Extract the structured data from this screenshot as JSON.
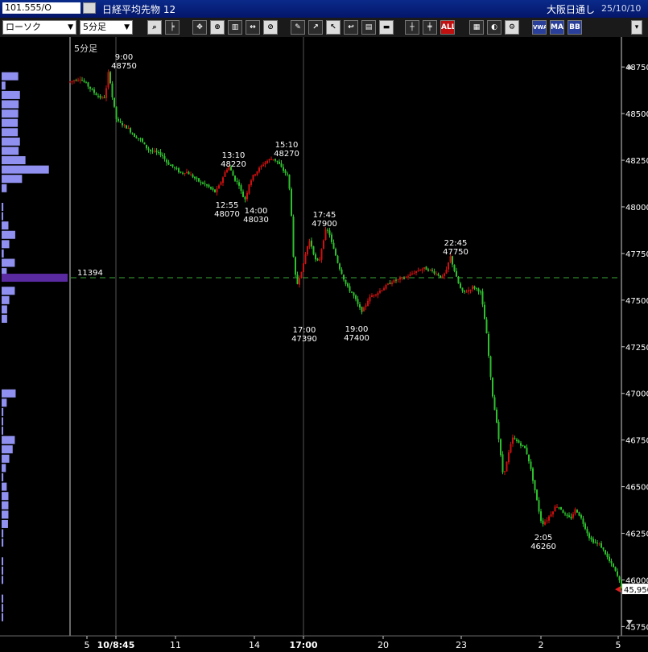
{
  "window": {
    "symbol": "101.555/O",
    "name": "日経平均先物 12",
    "market": "大阪日通し",
    "date": "25/10/10"
  },
  "toolbar": {
    "chart_type": "ローソク",
    "interval": "5分足",
    "buttons": [
      {
        "name": "zoom-button",
        "icon": "magnifier-icon"
      },
      {
        "name": "draw-lines-button",
        "icon": "lines-icon"
      },
      {
        "name": "cursor-tool-button",
        "icon": "cursor-icon"
      },
      {
        "name": "zoom-tool-button",
        "icon": "zoom-icon"
      },
      {
        "name": "bar-count-button",
        "icon": "bars-icon"
      },
      {
        "name": "stretch-button",
        "icon": "stretch-icon"
      },
      {
        "name": "disabled-button",
        "icon": "disabled-icon"
      },
      {
        "name": "pen-button",
        "icon": "pen-icon"
      },
      {
        "name": "trend-tool-button",
        "icon": "trend-icon"
      },
      {
        "name": "select-tool-button",
        "icon": "arrow-icon"
      },
      {
        "name": "undo-button",
        "icon": "undo-icon"
      },
      {
        "name": "memo-button",
        "icon": "memo-icon"
      },
      {
        "name": "delete-button",
        "icon": "trash-icon"
      },
      {
        "name": "candle-button",
        "icon": "candle-icon"
      },
      {
        "name": "candle2-button",
        "icon": "candle2-icon"
      },
      {
        "name": "all-button",
        "label": "ALL"
      },
      {
        "name": "pattern-button",
        "icon": "pattern-icon"
      },
      {
        "name": "color-button",
        "icon": "palette-icon"
      },
      {
        "name": "settings-button",
        "icon": "gear-icon"
      },
      {
        "name": "vwap-button",
        "label": "VWAP"
      },
      {
        "name": "ma-button",
        "label": "MA"
      },
      {
        "name": "bb-button",
        "label": "BB"
      }
    ]
  },
  "chart_data": {
    "type": "candlestick",
    "interval_label": "5分足",
    "ylim": [
      45750,
      48775
    ],
    "y_ticks": [
      48750,
      48500,
      48250,
      48000,
      47750,
      47500,
      47250,
      47000,
      46750,
      46500,
      46250,
      46000,
      45750
    ],
    "x_ticks": [
      "5",
      "10/8:45",
      "11",
      "14",
      "17:00",
      "20",
      "23",
      "2",
      "5"
    ],
    "current_price_label": "45,950",
    "current_price": 45950,
    "dashed_line_label": "11394",
    "dashed_line_price": 47620,
    "annotations": [
      {
        "time": "9:00",
        "price": 48750
      },
      {
        "time": "13:10",
        "price": 48220
      },
      {
        "time": "12:55",
        "price": 48070
      },
      {
        "time": "14:00",
        "price": 48030
      },
      {
        "time": "15:10",
        "price": 48270
      },
      {
        "time": "17:45",
        "price": 47900
      },
      {
        "time": "17:00",
        "price": 47390
      },
      {
        "time": "19:00",
        "price": 47400
      },
      {
        "time": "22:45",
        "price": 47750
      },
      {
        "time": "2:05",
        "price": 46260
      }
    ],
    "price_path": [
      [
        0,
        48670
      ],
      [
        6,
        48680
      ],
      [
        12,
        48690
      ],
      [
        20,
        48660
      ],
      [
        28,
        48620
      ],
      [
        36,
        48590
      ],
      [
        42,
        48580
      ],
      [
        46,
        48650
      ],
      [
        48,
        48740
      ],
      [
        52,
        48600
      ],
      [
        58,
        48460
      ],
      [
        66,
        48440
      ],
      [
        72,
        48420
      ],
      [
        80,
        48380
      ],
      [
        88,
        48360
      ],
      [
        94,
        48320
      ],
      [
        100,
        48300
      ],
      [
        108,
        48290
      ],
      [
        114,
        48280
      ],
      [
        120,
        48240
      ],
      [
        126,
        48220
      ],
      [
        132,
        48200
      ],
      [
        138,
        48180
      ],
      [
        144,
        48190
      ],
      [
        150,
        48170
      ],
      [
        156,
        48150
      ],
      [
        162,
        48130
      ],
      [
        168,
        48120
      ],
      [
        174,
        48100
      ],
      [
        180,
        48080
      ],
      [
        184,
        48100
      ],
      [
        188,
        48140
      ],
      [
        194,
        48200
      ],
      [
        198,
        48215
      ],
      [
        204,
        48150
      ],
      [
        210,
        48120
      ],
      [
        214,
        48060
      ],
      [
        218,
        48040
      ],
      [
        222,
        48120
      ],
      [
        228,
        48170
      ],
      [
        234,
        48200
      ],
      [
        240,
        48230
      ],
      [
        246,
        48250
      ],
      [
        252,
        48260
      ],
      [
        258,
        48240
      ],
      [
        264,
        48200
      ],
      [
        270,
        48170
      ],
      [
        274,
        48050
      ],
      [
        278,
        47680
      ],
      [
        282,
        47580
      ],
      [
        286,
        47640
      ],
      [
        290,
        47690
      ],
      [
        294,
        47780
      ],
      [
        298,
        47820
      ],
      [
        302,
        47760
      ],
      [
        306,
        47700
      ],
      [
        310,
        47720
      ],
      [
        314,
        47810
      ],
      [
        318,
        47880
      ],
      [
        322,
        47860
      ],
      [
        326,
        47790
      ],
      [
        330,
        47740
      ],
      [
        334,
        47680
      ],
      [
        338,
        47640
      ],
      [
        342,
        47590
      ],
      [
        346,
        47560
      ],
      [
        350,
        47540
      ],
      [
        354,
        47510
      ],
      [
        358,
        47470
      ],
      [
        362,
        47440
      ],
      [
        366,
        47460
      ],
      [
        370,
        47500
      ],
      [
        376,
        47530
      ],
      [
        382,
        47540
      ],
      [
        388,
        47560
      ],
      [
        394,
        47580
      ],
      [
        400,
        47600
      ],
      [
        408,
        47610
      ],
      [
        416,
        47620
      ],
      [
        424,
        47640
      ],
      [
        432,
        47660
      ],
      [
        440,
        47670
      ],
      [
        448,
        47660
      ],
      [
        456,
        47640
      ],
      [
        462,
        47620
      ],
      [
        468,
        47660
      ],
      [
        472,
        47740
      ],
      [
        476,
        47680
      ],
      [
        480,
        47620
      ],
      [
        484,
        47570
      ],
      [
        488,
        47540
      ],
      [
        494,
        47550
      ],
      [
        500,
        47570
      ],
      [
        506,
        47560
      ],
      [
        510,
        47540
      ],
      [
        514,
        47430
      ],
      [
        518,
        47300
      ],
      [
        522,
        47100
      ],
      [
        526,
        46950
      ],
      [
        530,
        46850
      ],
      [
        534,
        46700
      ],
      [
        538,
        46560
      ],
      [
        542,
        46620
      ],
      [
        546,
        46700
      ],
      [
        550,
        46760
      ],
      [
        556,
        46740
      ],
      [
        562,
        46720
      ],
      [
        566,
        46700
      ],
      [
        570,
        46640
      ],
      [
        574,
        46560
      ],
      [
        578,
        46470
      ],
      [
        582,
        46380
      ],
      [
        586,
        46300
      ],
      [
        592,
        46320
      ],
      [
        598,
        46360
      ],
      [
        604,
        46400
      ],
      [
        610,
        46380
      ],
      [
        616,
        46340
      ],
      [
        622,
        46330
      ],
      [
        628,
        46380
      ],
      [
        634,
        46340
      ],
      [
        640,
        46280
      ],
      [
        646,
        46220
      ],
      [
        652,
        46200
      ],
      [
        658,
        46190
      ],
      [
        664,
        46150
      ],
      [
        670,
        46100
      ],
      [
        676,
        46060
      ],
      [
        682,
        46000
      ],
      [
        688,
        45920
      ],
      [
        692,
        45950
      ]
    ],
    "volume_profile": [
      {
        "price": 48700,
        "volume": 3900
      },
      {
        "price": 48650,
        "volume": 900
      },
      {
        "price": 48600,
        "volume": 4300
      },
      {
        "price": 48550,
        "volume": 4000
      },
      {
        "price": 48500,
        "volume": 3900
      },
      {
        "price": 48450,
        "volume": 3800
      },
      {
        "price": 48400,
        "volume": 3800
      },
      {
        "price": 48350,
        "volume": 4300
      },
      {
        "price": 48300,
        "volume": 4000
      },
      {
        "price": 48250,
        "volume": 5600
      },
      {
        "price": 48200,
        "volume": 11100
      },
      {
        "price": 48150,
        "volume": 4800
      },
      {
        "price": 48100,
        "volume": 1200
      },
      {
        "price": 48050,
        "volume": 0
      },
      {
        "price": 48000,
        "volume": 400
      },
      {
        "price": 47950,
        "volume": 300
      },
      {
        "price": 47900,
        "volume": 1600
      },
      {
        "price": 47850,
        "volume": 3200
      },
      {
        "price": 47800,
        "volume": 1800
      },
      {
        "price": 47750,
        "volume": 500
      },
      {
        "price": 47700,
        "volume": 3100
      },
      {
        "price": 47650,
        "volume": 1200
      },
      {
        "price": 47620,
        "volume": 15500
      },
      {
        "price": 47550,
        "volume": 3100
      },
      {
        "price": 47500,
        "volume": 1800
      },
      {
        "price": 47450,
        "volume": 1300
      },
      {
        "price": 47400,
        "volume": 1300
      },
      {
        "price": 47000,
        "volume": 3300
      },
      {
        "price": 46950,
        "volume": 1200
      },
      {
        "price": 46900,
        "volume": 400
      },
      {
        "price": 46850,
        "volume": 300
      },
      {
        "price": 46800,
        "volume": 300
      },
      {
        "price": 46750,
        "volume": 3100
      },
      {
        "price": 46700,
        "volume": 2600
      },
      {
        "price": 46650,
        "volume": 1800
      },
      {
        "price": 46600,
        "volume": 1000
      },
      {
        "price": 46550,
        "volume": 400
      },
      {
        "price": 46500,
        "volume": 1200
      },
      {
        "price": 46450,
        "volume": 1600
      },
      {
        "price": 46400,
        "volume": 1600
      },
      {
        "price": 46350,
        "volume": 1600
      },
      {
        "price": 46300,
        "volume": 1500
      },
      {
        "price": 46250,
        "volume": 400
      },
      {
        "price": 46200,
        "volume": 400
      },
      {
        "price": 46100,
        "volume": 300
      },
      {
        "price": 46050,
        "volume": 300
      },
      {
        "price": 46000,
        "volume": 300
      },
      {
        "price": 45900,
        "volume": 300
      },
      {
        "price": 45850,
        "volume": 300
      },
      {
        "price": 45800,
        "volume": 300
      }
    ]
  },
  "colors": {
    "up": "#d01010",
    "down": "#2ec02e",
    "wick": "#d8d8d8",
    "volume": "#9090f0",
    "volume_highlight": "#5a2aa0",
    "dashed_line": "#38a838",
    "price_tag": "#ffffff",
    "price_arrow": "#e02020"
  }
}
